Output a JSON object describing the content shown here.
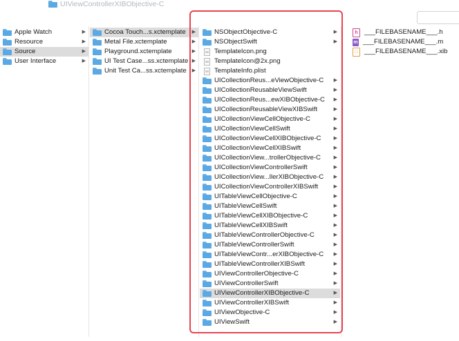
{
  "window": {
    "title": "UIViewControllerXIBObjective-C"
  },
  "columns": {
    "col1": [
      {
        "label": "Apple Watch",
        "icon": "folder-icon",
        "arrow": true,
        "selected": false
      },
      {
        "label": "Resource",
        "icon": "folder-icon",
        "arrow": true,
        "selected": false
      },
      {
        "label": "Source",
        "icon": "folder-icon",
        "arrow": true,
        "selected": true
      },
      {
        "label": "User Interface",
        "icon": "folder-icon",
        "arrow": true,
        "selected": false
      }
    ],
    "col2": [
      {
        "label": "Cocoa Touch...s.xctemplate",
        "icon": "folder-icon",
        "arrow": true,
        "selected": true
      },
      {
        "label": "Metal File.xctemplate",
        "icon": "folder-icon",
        "arrow": true,
        "selected": false
      },
      {
        "label": "Playground.xctemplate",
        "icon": "folder-icon",
        "arrow": true,
        "selected": false
      },
      {
        "label": "UI Test Case...ss.xctemplate",
        "icon": "folder-icon",
        "arrow": true,
        "selected": false
      },
      {
        "label": "Unit Test Ca...ss.xctemplate",
        "icon": "folder-icon",
        "arrow": true,
        "selected": false
      }
    ],
    "col3": [
      {
        "label": "NSObjectObjective-C",
        "icon": "folder-icon",
        "arrow": true,
        "selected": false
      },
      {
        "label": "NSObjectSwift",
        "icon": "folder-icon",
        "arrow": true,
        "selected": false
      },
      {
        "label": "TemplateIcon.png",
        "icon": "image-file-icon",
        "arrow": false,
        "selected": false
      },
      {
        "label": "TemplateIcon@2x.png",
        "icon": "image-file-icon",
        "arrow": false,
        "selected": false
      },
      {
        "label": "TemplateInfo.plist",
        "icon": "plist-file-icon",
        "arrow": false,
        "selected": false
      },
      {
        "label": "UICollectionReus...eViewObjective-C",
        "icon": "folder-icon",
        "arrow": true,
        "selected": false
      },
      {
        "label": "UICollectionReusableViewSwift",
        "icon": "folder-icon",
        "arrow": true,
        "selected": false
      },
      {
        "label": "UICollectionReus...ewXIBObjective-C",
        "icon": "folder-icon",
        "arrow": true,
        "selected": false
      },
      {
        "label": "UICollectionReusableViewXIBSwift",
        "icon": "folder-icon",
        "arrow": true,
        "selected": false
      },
      {
        "label": "UICollectionViewCellObjective-C",
        "icon": "folder-icon",
        "arrow": true,
        "selected": false
      },
      {
        "label": "UICollectionViewCellSwift",
        "icon": "folder-icon",
        "arrow": true,
        "selected": false
      },
      {
        "label": "UICollectionViewCellXIBObjective-C",
        "icon": "folder-icon",
        "arrow": true,
        "selected": false
      },
      {
        "label": "UICollectionViewCellXIBSwift",
        "icon": "folder-icon",
        "arrow": true,
        "selected": false
      },
      {
        "label": "UICollectionView...trollerObjective-C",
        "icon": "folder-icon",
        "arrow": true,
        "selected": false
      },
      {
        "label": "UICollectionViewControllerSwift",
        "icon": "folder-icon",
        "arrow": true,
        "selected": false
      },
      {
        "label": "UICollectionView...llerXIBObjective-C",
        "icon": "folder-icon",
        "arrow": true,
        "selected": false
      },
      {
        "label": "UICollectionViewControllerXIBSwift",
        "icon": "folder-icon",
        "arrow": true,
        "selected": false
      },
      {
        "label": "UITableViewCellObjective-C",
        "icon": "folder-icon",
        "arrow": true,
        "selected": false
      },
      {
        "label": "UITableViewCellSwift",
        "icon": "folder-icon",
        "arrow": true,
        "selected": false
      },
      {
        "label": "UITableViewCellXIBObjective-C",
        "icon": "folder-icon",
        "arrow": true,
        "selected": false
      },
      {
        "label": "UITableViewCellXIBSwift",
        "icon": "folder-icon",
        "arrow": true,
        "selected": false
      },
      {
        "label": "UITableViewControllerObjective-C",
        "icon": "folder-icon",
        "arrow": true,
        "selected": false
      },
      {
        "label": "UITableViewControllerSwift",
        "icon": "folder-icon",
        "arrow": true,
        "selected": false
      },
      {
        "label": "UITableViewContr...erXIBObjective-C",
        "icon": "folder-icon",
        "arrow": true,
        "selected": false
      },
      {
        "label": "UITableViewControllerXIBSwift",
        "icon": "folder-icon",
        "arrow": true,
        "selected": false
      },
      {
        "label": "UIViewControllerObjective-C",
        "icon": "folder-icon",
        "arrow": true,
        "selected": false
      },
      {
        "label": "UIViewControllerSwift",
        "icon": "folder-icon",
        "arrow": true,
        "selected": false
      },
      {
        "label": "UIViewControllerXIBObjective-C",
        "icon": "folder-icon",
        "arrow": true,
        "selected": true
      },
      {
        "label": "UIViewControllerXIBSwift",
        "icon": "folder-icon",
        "arrow": true,
        "selected": false
      },
      {
        "label": "UIViewObjective-C",
        "icon": "folder-icon",
        "arrow": true,
        "selected": false
      },
      {
        "label": "UIViewSwift",
        "icon": "folder-icon",
        "arrow": true,
        "selected": false
      }
    ],
    "col4": [
      {
        "label": "___FILEBASENAME___.h",
        "icon": "header-file-icon",
        "badge": "h"
      },
      {
        "label": "___FILEBASENAME___.m",
        "icon": "source-file-icon",
        "badge": "m"
      },
      {
        "label": "___FILEBASENAME___.xib",
        "icon": "xib-file-icon",
        "badge": "□"
      }
    ]
  },
  "colors": {
    "selection": "#dcdcdc",
    "folder": "#5aa8e4",
    "highlight_box": "#e8434f",
    "title_text": "#b0b9c4"
  }
}
